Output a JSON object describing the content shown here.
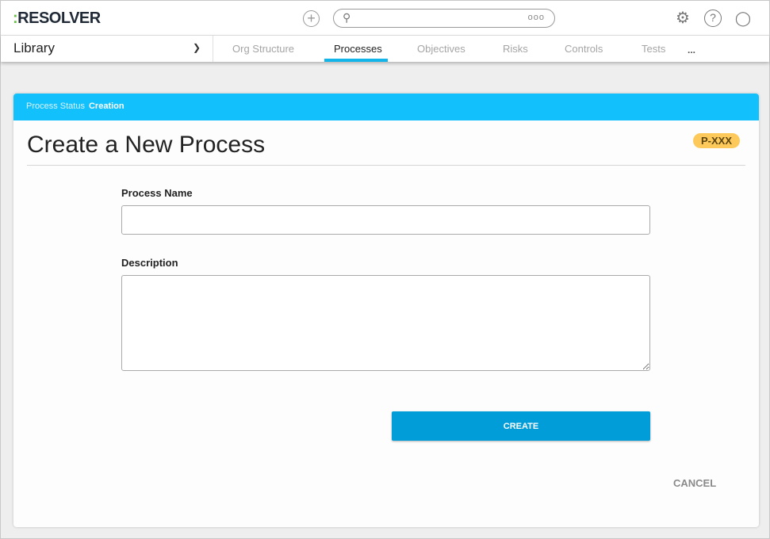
{
  "header": {
    "logo": "RESOLVER",
    "icons": [
      "plus-circle-icon",
      "search-icon",
      "more-icon",
      "gear-icon",
      "help-icon",
      "user-icon"
    ]
  },
  "nav": {
    "library": "Library",
    "tabs": [
      "Org Structure",
      "Processes",
      "Objectives",
      "Risks",
      "Controls",
      "Tests"
    ],
    "active": "Processes",
    "more": "..."
  },
  "form": {
    "status_label": "Process Status",
    "status_value": "Creation",
    "title": "Create a New Process",
    "badge": "P-XXX",
    "name_label": "Process Name",
    "name_value": "",
    "desc_label": "Description",
    "desc_value": "",
    "create": "CREATE",
    "cancel": "CANCEL"
  },
  "colors": {
    "accent": "#12c0fb",
    "button": "#019dd9",
    "badge": "#fdc95a"
  }
}
